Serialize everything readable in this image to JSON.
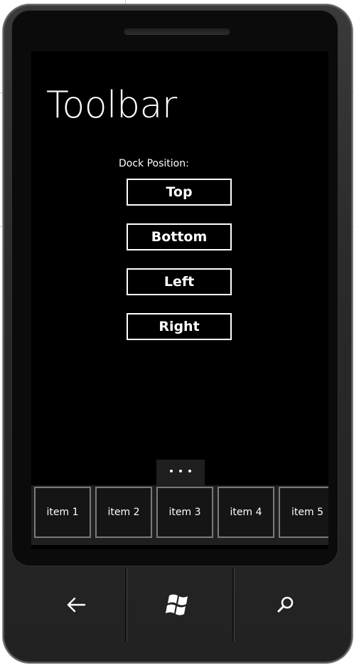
{
  "page": {
    "title": "Toolbar"
  },
  "dock": {
    "label": "Dock Position:",
    "buttons": [
      "Top",
      "Bottom",
      "Left",
      "Right"
    ]
  },
  "appbar": {
    "items": [
      "item 1",
      "item 2",
      "item 3",
      "item 4",
      "item 5"
    ]
  },
  "hardware": {
    "back_icon": "back-arrow-icon",
    "start_icon": "windows-logo-icon",
    "search_icon": "search-icon"
  },
  "colors": {
    "screen_bg": "#000000",
    "text": "#ffffff",
    "appbar_bg": "#1f1f1f",
    "item_border": "#7a7a7a"
  }
}
